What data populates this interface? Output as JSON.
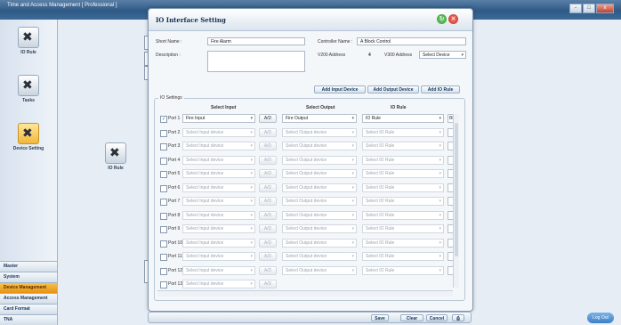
{
  "app": {
    "title": "Time and Access Management [ Professional ]"
  },
  "window_controls": [
    "-",
    "□",
    "x"
  ],
  "sidebar": {
    "items": [
      {
        "label": "IO Rule",
        "icon": "tool-icon"
      },
      {
        "label": "Tasks",
        "icon": "tool-icon"
      },
      {
        "label": "Device Setting",
        "icon": "folder-tool-icon"
      }
    ],
    "tabs": [
      {
        "label": "Master",
        "active": false
      },
      {
        "label": "System",
        "active": false
      },
      {
        "label": "Device Management",
        "active": true
      },
      {
        "label": "Access Management",
        "active": false
      },
      {
        "label": "Card Format",
        "active": false
      },
      {
        "label": "TNA",
        "active": false
      }
    ]
  },
  "mid_panel": {
    "label": "IO Rule"
  },
  "dialog": {
    "title": "IO Interface Setting",
    "short_name_label": "Short Name :",
    "short_name_value": "Fire Alarm",
    "description_label": "Description :",
    "description_value": "",
    "controller_name_label": "Controller Name :",
    "controller_name_value": "A Block Control",
    "v200_address_label": "V200 Address",
    "v200_address_value": "4",
    "v300_address_label": "V300 Address",
    "v300_address_value": "Select Device",
    "add_input_label": "Add Input Device",
    "add_output_label": "Add Output Device",
    "add_rule_label": "Add IO Rule",
    "group_label": "IO Settings",
    "col_input": "Select Input",
    "col_output": "Select Output",
    "col_rule": "IO Rule",
    "ad_label": "A/D",
    "rows": [
      {
        "port": "Port 1",
        "checked": true,
        "input": "Fire Input",
        "output": "Fire Output",
        "rule": "IO Rule",
        "extra": "Blo"
      },
      {
        "port": "Port 2",
        "checked": false,
        "input": "Select Input device",
        "output": "Select Output device",
        "rule": "Select IO Rule",
        "extra": ""
      },
      {
        "port": "Port 3",
        "checked": false,
        "input": "Select Input device",
        "output": "Select Output device",
        "rule": "Select IO Rule",
        "extra": ""
      },
      {
        "port": "Port 4",
        "checked": false,
        "input": "Select Input device",
        "output": "Select Output device",
        "rule": "Select IO Rule",
        "extra": ""
      },
      {
        "port": "Port 5",
        "checked": false,
        "input": "Select Input device",
        "output": "Select Output device",
        "rule": "Select IO Rule",
        "extra": ""
      },
      {
        "port": "Port 6",
        "checked": false,
        "input": "Select Input device",
        "output": "Select Output device",
        "rule": "Select IO Rule",
        "extra": ""
      },
      {
        "port": "Port 7",
        "checked": false,
        "input": "Select Input device",
        "output": "Select Output device",
        "rule": "Select IO Rule",
        "extra": ""
      },
      {
        "port": "Port 8",
        "checked": false,
        "input": "Select Input device",
        "output": "Select Output device",
        "rule": "Select IO Rule",
        "extra": ""
      },
      {
        "port": "Port 9",
        "checked": false,
        "input": "Select Input device",
        "output": "Select Output device",
        "rule": "Select IO Rule",
        "extra": ""
      },
      {
        "port": "Port 10",
        "checked": false,
        "input": "Select Input device",
        "output": "Select Output device",
        "rule": "Select IO Rule",
        "extra": ""
      },
      {
        "port": "Port 11",
        "checked": false,
        "input": "Select Input device",
        "output": "Select Output device",
        "rule": "Select IO Rule",
        "extra": ""
      },
      {
        "port": "Port 12",
        "checked": false,
        "input": "Select Input device",
        "output": "Select Output device",
        "rule": "Select IO Rule",
        "extra": ""
      },
      {
        "port": "Port 13",
        "checked": false,
        "input": "Select Input device",
        "output": "",
        "rule": "",
        "extra": ""
      }
    ]
  },
  "bottom": {
    "save_label": "Save",
    "clear_label": "Clear",
    "cancel_label": "Cancel"
  },
  "logout_label": "Log Out"
}
